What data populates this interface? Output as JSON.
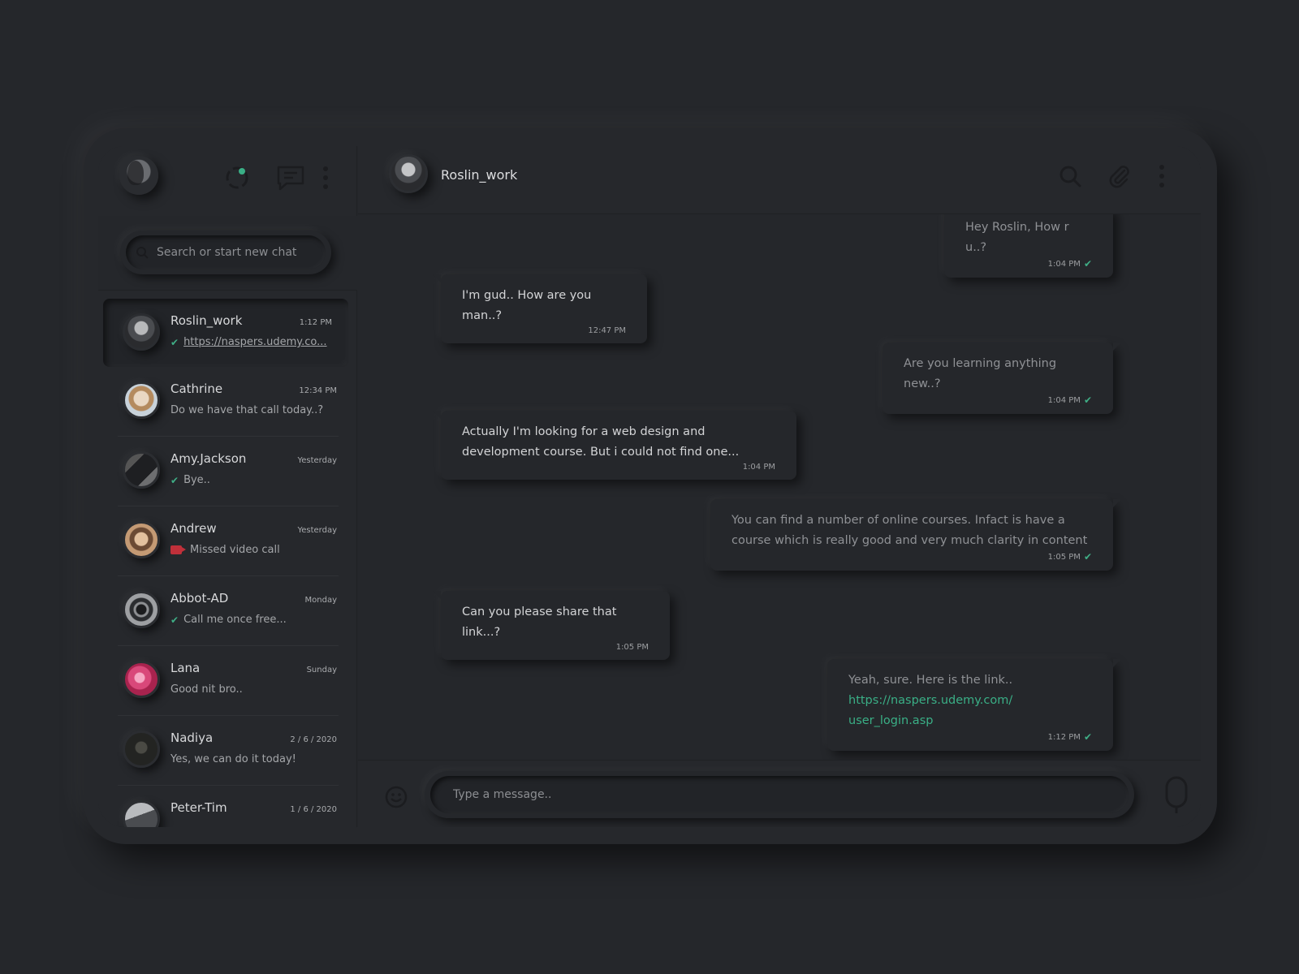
{
  "sidebar": {
    "search": {
      "placeholder": "Search or start new chat"
    },
    "chats": [
      {
        "name": "Roslin_work",
        "time": "1:12 PM",
        "last": "https://naspers.udemy.co...",
        "status": "read",
        "avatar_color": "#4a4c50"
      },
      {
        "name": "Cathrine",
        "time": "12:34 PM",
        "last": "Do we have that call today..?",
        "status": "none",
        "avatar_color": "#b7a898"
      },
      {
        "name": "Amy.Jackson",
        "time": "Yesterday",
        "last": "Bye..",
        "status": "read",
        "avatar_color": "#3a3b3e"
      },
      {
        "name": "Andrew",
        "time": "Yesterday",
        "last": "Missed video call",
        "status": "missed-video",
        "avatar_color": "#9a7a5e"
      },
      {
        "name": "Abbot-AD",
        "time": "Monday",
        "last": "Call me once free...",
        "status": "read",
        "avatar_color": "#55585c"
      },
      {
        "name": "Lana",
        "time": "Sunday",
        "last": "Good nit bro..",
        "status": "none",
        "avatar_color": "#d2527e"
      },
      {
        "name": "Nadiya",
        "time": "2 / 6 / 2020",
        "last": "Yes, we can do it today!",
        "status": "none",
        "avatar_color": "#2a2c2a"
      },
      {
        "name": "Peter-Tim",
        "time": "1 / 6 / 2020",
        "last": "",
        "status": "none",
        "avatar_color": "#6a6c70"
      }
    ]
  },
  "chat": {
    "contact_name": "Roslin_work",
    "messages": [
      {
        "dir": "out",
        "text": "Hey Roslin, How r u..?",
        "time": "1:04 PM"
      },
      {
        "dir": "in",
        "text": "I'm gud.. How are you man..?",
        "time": "12:47 PM"
      },
      {
        "dir": "out",
        "text": "Are you learning anything new..?",
        "time": "1:04 PM"
      },
      {
        "dir": "in",
        "text": "Actually I'm looking for a web design and development course. But i could not find one...",
        "time": "1:04 PM"
      },
      {
        "dir": "out",
        "text": "You can find a number of online courses. Infact is have a course which is really good and very much clarity in content",
        "time": "1:05 PM"
      },
      {
        "dir": "in",
        "text": "Can you please share that link...?",
        "time": "1:05 PM"
      },
      {
        "dir": "out",
        "text": "Yeah, sure. Here is the link..",
        "link": "https://naspers.udemy.com/ user_login.asp",
        "time": "1:12 PM"
      }
    ],
    "composer": {
      "placeholder": "Type a message.."
    }
  },
  "colors": {
    "background": "#25272b",
    "accent": "#3aaf86",
    "missed_call": "#c0303a",
    "text_primary": "#d7d8da",
    "text_muted": "#8f9195"
  },
  "icons": {
    "header_left": [
      "status-icon",
      "new-chat-icon",
      "menu-icon"
    ],
    "header_right": [
      "search-icon",
      "paperclip-icon",
      "more-vertical-icon"
    ],
    "composer": [
      "emoji-icon",
      "microphone-icon"
    ]
  }
}
